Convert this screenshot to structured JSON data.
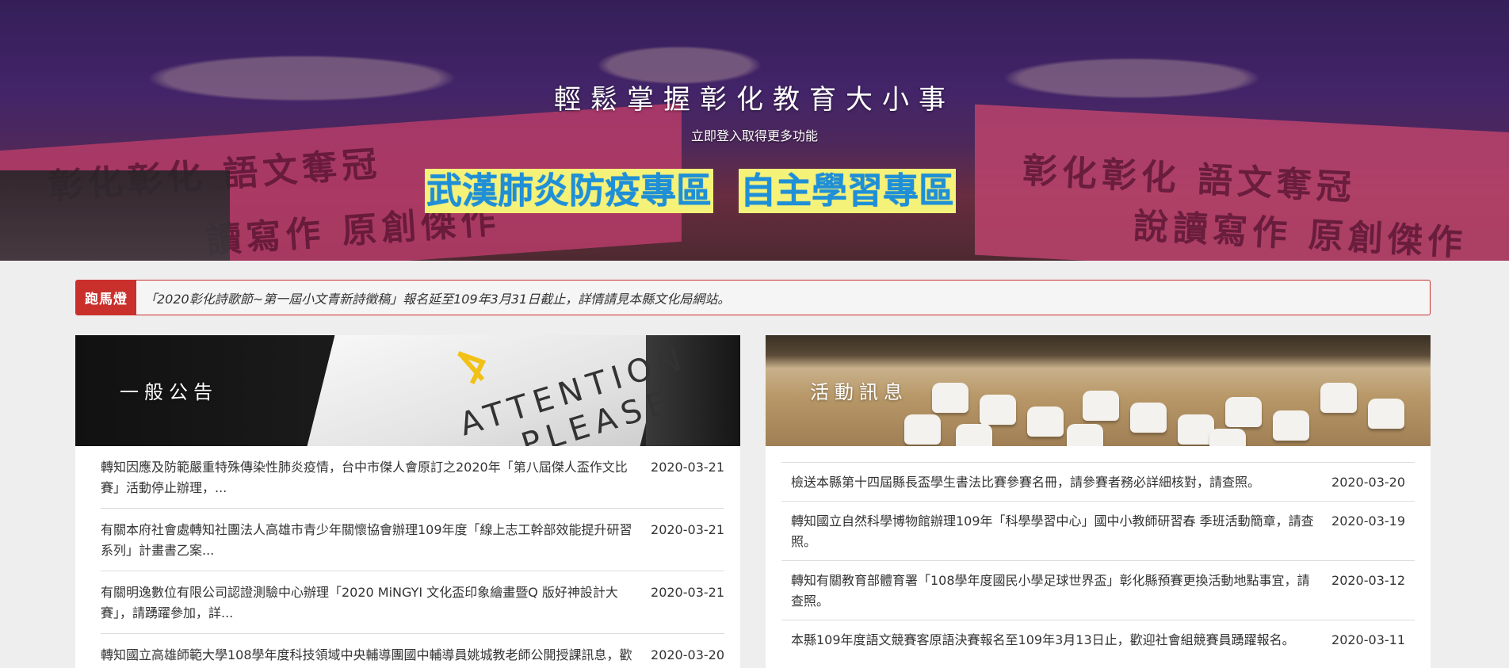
{
  "hero": {
    "title": "輕鬆掌握彰化教育大小事",
    "subtitle": "立即登入取得更多功能",
    "zone_links": [
      "武漢肺炎防疫專區",
      "自主學習專區"
    ],
    "banner_text_left": "彰化彰化  語文奪冠",
    "banner_text_left2": "讀寫作  原創傑作",
    "banner_text_right": "彰化彰化  語文奪冠",
    "banner_text_right2": "說讀寫作  原創傑作"
  },
  "marquee": {
    "label": "跑馬燈",
    "text": "「2020彰化詩歌節~第一屆小文青新詩徵稿」報名延至109年3月31日截止，詳情請見本縣文化局網站。"
  },
  "announcements": {
    "title": "一般公告",
    "header_sign_line1": "ATTENTION",
    "header_sign_line2": "PLEASE",
    "items": [
      {
        "title": "轉知因應及防範嚴重特殊傳染性肺炎疫情，台中市傑人會原訂之2020年「第八屆傑人盃作文比賽」活動停止辦理，...",
        "date": "2020-03-21"
      },
      {
        "title": "有關本府社會處轉知社團法人高雄市青少年關懷協會辦理109年度「線上志工幹部效能提升研習系列」計畫書乙案...",
        "date": "2020-03-21"
      },
      {
        "title": "有關明逸數位有限公司認證測驗中心辦理「2020 MiNGYI 文化盃印象繪畫暨Q 版好神設計大賽」，請踴躍參加，詳...",
        "date": "2020-03-21"
      },
      {
        "title": "轉知國立高雄師範大學108學年度科技領域中央輔導團國中輔導員姚城教老師公開授課訊息，歡",
        "date": "2020-03-20"
      }
    ]
  },
  "events": {
    "title": "活動訊息",
    "items": [
      {
        "title": "檢送本縣第十四屆縣長盃學生書法比賽參賽名冊，請參賽者務必詳細核對，請查照。",
        "date": "2020-03-20"
      },
      {
        "title": "轉知國立自然科學博物館辦理109年「科學學習中心」國中小教師研習春 季班活動簡章，請查照。",
        "date": "2020-03-19"
      },
      {
        "title": "轉知有關教育部體育署「108學年度國民小學足球世界盃」彰化縣預賽更換活動地點事宜，請查照。",
        "date": "2020-03-12"
      },
      {
        "title": "本縣109年度語文競賽客原語決賽報名至109年3月13日止，歡迎社會組競賽員踴躍報名。",
        "date": "2020-03-11"
      }
    ]
  },
  "colors": {
    "zone_link_bg": "#f5f27a",
    "zone_link_text": "#1f8fd6",
    "marquee_accent": "#c9302c"
  }
}
